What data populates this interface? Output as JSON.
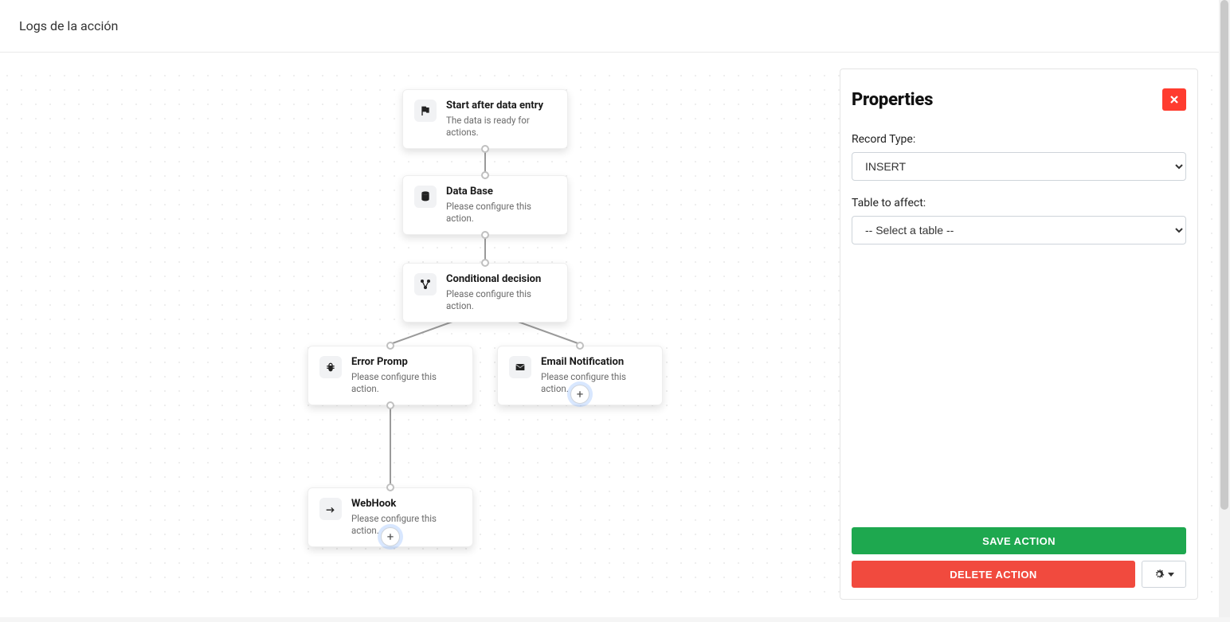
{
  "header": {
    "title": "Logs de la acción"
  },
  "nodes": {
    "start": {
      "title": "Start after data entry",
      "subtitle": "The data is ready for actions."
    },
    "database": {
      "title": "Data Base",
      "subtitle": "Please configure this action."
    },
    "condition": {
      "title": "Conditional decision",
      "subtitle": "Please configure this action."
    },
    "error": {
      "title": "Error Promp",
      "subtitle": "Please configure this action."
    },
    "email": {
      "title": "Email Notification",
      "subtitle": "Please configure this action."
    },
    "webhook": {
      "title": "WebHook",
      "subtitle": "Please configure this action."
    }
  },
  "add_button_glyph": "+",
  "panel": {
    "title": "Properties",
    "fields": {
      "record_type": {
        "label": "Record Type:",
        "value": "INSERT",
        "options": [
          "INSERT"
        ]
      },
      "table": {
        "label": "Table to affect:",
        "value": "-- Select a table --",
        "options": [
          "-- Select a table --"
        ]
      }
    },
    "buttons": {
      "save": "SAVE ACTION",
      "delete": "DELETE ACTION"
    }
  }
}
